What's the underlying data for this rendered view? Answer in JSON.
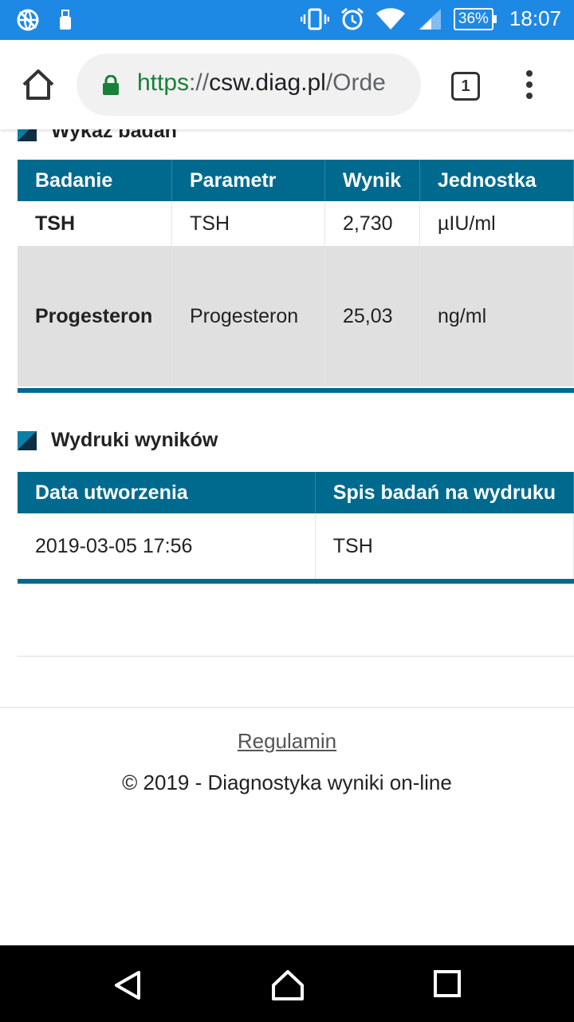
{
  "status_bar": {
    "battery": "36%",
    "time": "18:07",
    "icons": [
      "vpn-globe-icon",
      "usb-icon",
      "vibrate-icon",
      "alarm-icon",
      "wifi-icon",
      "signal-icon",
      "battery-icon"
    ]
  },
  "browser": {
    "url_scheme": "https",
    "url_sep": "://",
    "url_host": "csw.diag.pl",
    "url_rest": "/Orde",
    "tab_count": "1"
  },
  "section1": {
    "title": "Wykaz badań",
    "headers": [
      "Badanie",
      "Parametr",
      "Wynik",
      "Jednostka"
    ],
    "rows": [
      {
        "badanie": "TSH",
        "parametr": "TSH",
        "wynik": "2,730",
        "jednostka": "µIU/ml"
      },
      {
        "badanie": "Progesteron",
        "parametr": "Progesteron",
        "wynik": "25,03",
        "jednostka": "ng/ml"
      }
    ]
  },
  "section2": {
    "title": "Wydruki wyników",
    "headers": [
      "Data utworzenia",
      "Spis badań na wydruku"
    ],
    "rows": [
      {
        "data": "2019-03-05 17:56",
        "spis": "TSH"
      }
    ]
  },
  "footer": {
    "regulamin": "Regulamin",
    "copyright": "© 2019 - Diagnostyka wyniki on-line"
  },
  "colors": {
    "status_bar": "#1e88e5",
    "table_header": "#006a8e",
    "row_alt": "#e0e0e0"
  }
}
